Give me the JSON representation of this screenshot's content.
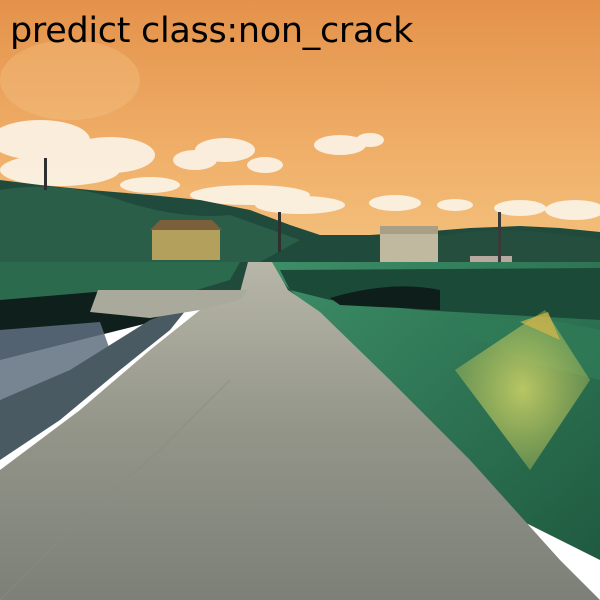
{
  "overlay": {
    "prediction_label": "predict class:non_crack"
  },
  "scene": {
    "description_colors": {
      "sky_top": "#e89a4e",
      "sky_bottom": "#f0b46c",
      "vegetation": "#2a6a4a",
      "road": "#8a8e86"
    }
  }
}
